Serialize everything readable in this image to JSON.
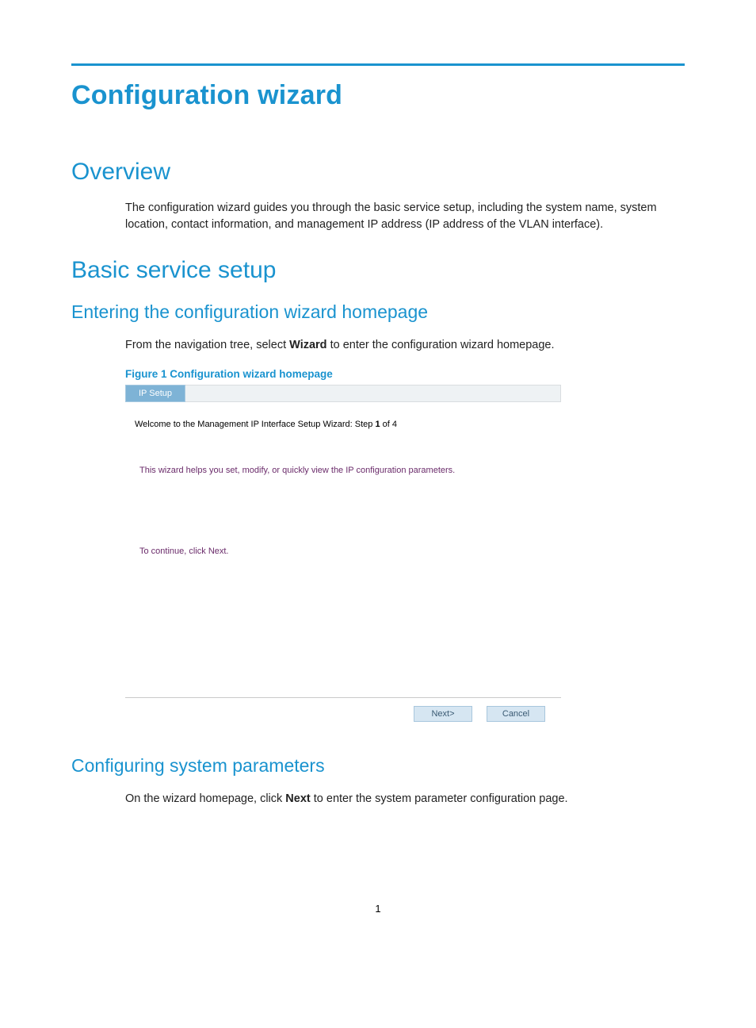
{
  "title": "Configuration wizard",
  "sections": {
    "overview": {
      "heading": "Overview",
      "paragraph": "The configuration wizard guides you through the basic service setup, including the system name, system location, contact information, and management IP address (IP address of the VLAN interface)."
    },
    "basic": {
      "heading": "Basic service setup",
      "entering": {
        "heading": "Entering the configuration wizard homepage",
        "intro_before": "From the navigation tree, select ",
        "intro_bold": "Wizard",
        "intro_after": " to enter the configuration wizard homepage.",
        "figure_caption": "Figure 1 Configuration wizard homepage"
      },
      "configuring": {
        "heading": "Configuring system parameters",
        "intro_before": "On the wizard homepage, click ",
        "intro_bold": "Next",
        "intro_after": " to enter the system parameter configuration page."
      }
    }
  },
  "wizard": {
    "tab_label": "IP Setup",
    "welcome_prefix": "Welcome to the Management IP Interface Setup Wizard:  Step ",
    "step_current": "1",
    "welcome_suffix": " of 4",
    "description": "This wizard helps you set, modify, or quickly view the IP configuration parameters.",
    "continue_text": "To continue, click Next.",
    "buttons": {
      "next": "Next>",
      "cancel": "Cancel"
    }
  },
  "page_number": "1"
}
